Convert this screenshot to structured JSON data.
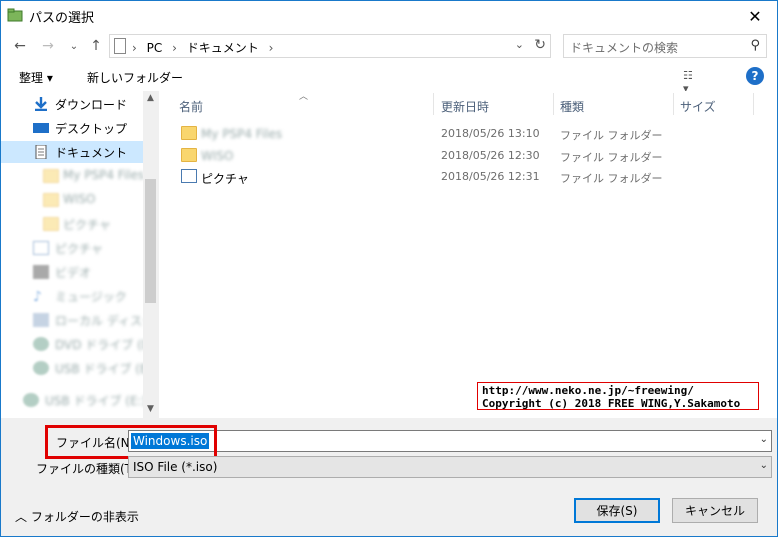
{
  "window": {
    "title": "パスの選択",
    "close_glyph": "✕"
  },
  "address": {
    "crumbs": [
      "PC",
      "ドキュメント"
    ],
    "search_placeholder": "ドキュメントの検索"
  },
  "toolbar": {
    "organize": "整理 ▾",
    "new_folder": "新しいフォルダー",
    "help": "?"
  },
  "nav": {
    "items": [
      {
        "label": "ダウンロード",
        "blur": false
      },
      {
        "label": "デスクトップ",
        "blur": false
      },
      {
        "label": "ドキュメント",
        "blur": false,
        "selected": true
      },
      {
        "label": "My PSP4 Files",
        "blur": true,
        "sub": true
      },
      {
        "label": "WISO",
        "blur": true,
        "sub": true
      },
      {
        "label": "ピクチャ",
        "blur": true,
        "sub": true
      },
      {
        "label": "ピクチャ",
        "blur": true
      },
      {
        "label": "ビデオ",
        "blur": true
      },
      {
        "label": "ミュージック",
        "blur": true
      },
      {
        "label": "ローカル ディスク (C:)",
        "blur": true
      },
      {
        "label": "DVD ドライブ (D:)",
        "blur": true
      },
      {
        "label": "USB ドライブ (E:)",
        "blur": true
      },
      {
        "label": "USB ドライブ (E:)",
        "blur": true
      }
    ]
  },
  "filelist": {
    "columns": [
      "名前",
      "更新日時",
      "種類",
      "サイズ"
    ],
    "rows": [
      {
        "name": "My PSP4 Files",
        "date": "2018/05/26 13:10",
        "type": "ファイル フォルダー",
        "blur": true,
        "icon": "folder"
      },
      {
        "name": "WISO",
        "date": "2018/05/26 12:30",
        "type": "ファイル フォルダー",
        "blur": true,
        "icon": "folder"
      },
      {
        "name": "ピクチャ",
        "date": "2018/05/26 12:31",
        "type": "ファイル フォルダー",
        "blur": false,
        "icon": "picture"
      }
    ]
  },
  "overlay": {
    "line1": "http://www.neko.ne.jp/~freewing/",
    "line2": "Copyright (c) 2018 FREE WING,Y.Sakamoto"
  },
  "bottom": {
    "filename_label": "ファイル名(N):",
    "filename_value": "Windows.iso",
    "filetype_label": "ファイルの種類(T):",
    "filetype_value": "ISO File (*.iso)",
    "hide_folders": "フォルダーの非表示",
    "save": "保存(S)",
    "cancel": "キャンセル"
  }
}
